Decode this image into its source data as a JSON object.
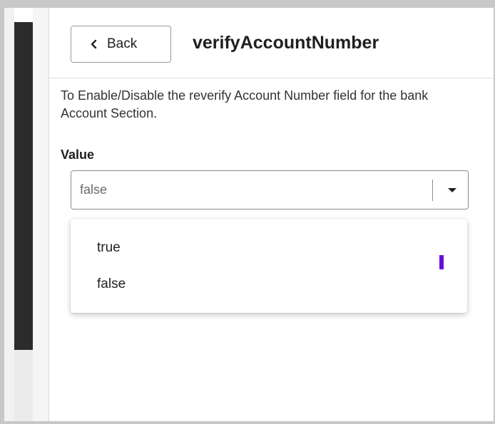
{
  "header": {
    "back_label": "Back",
    "title": "verifyAccountNumber"
  },
  "description": "To Enable/Disable the reverify Account Number field for the bank Account Section.",
  "value_field": {
    "label": "Value",
    "selected": "false"
  },
  "dropdown": {
    "options": [
      "true",
      "false"
    ]
  },
  "colors": {
    "accent_cursor": "#6a0dd6",
    "dark_sidebar": "#2b2b2b"
  },
  "icons": {
    "back": "chevron-left-icon",
    "dropdown": "caret-down-icon"
  }
}
